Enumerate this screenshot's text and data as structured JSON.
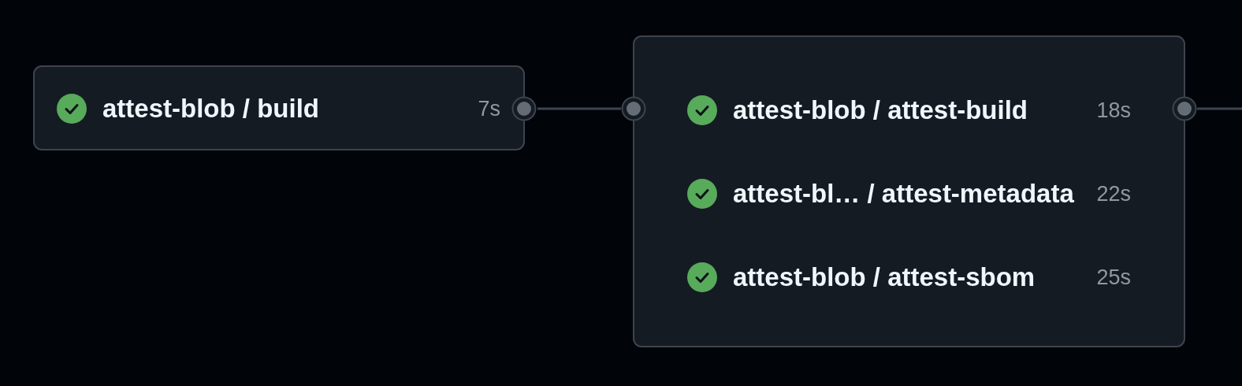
{
  "nodes": [
    {
      "jobs": [
        {
          "name": "attest-blob / build",
          "duration": "7s",
          "kind": "success"
        }
      ]
    },
    {
      "jobs": [
        {
          "name": "attest-blob / attest-build",
          "duration": "18s",
          "kind": "success"
        },
        {
          "name": "attest-bl… / attest-metadata",
          "duration": "22s",
          "kind": "success"
        },
        {
          "name": "attest-blob / attest-sbom",
          "duration": "25s",
          "kind": "success"
        }
      ]
    }
  ]
}
